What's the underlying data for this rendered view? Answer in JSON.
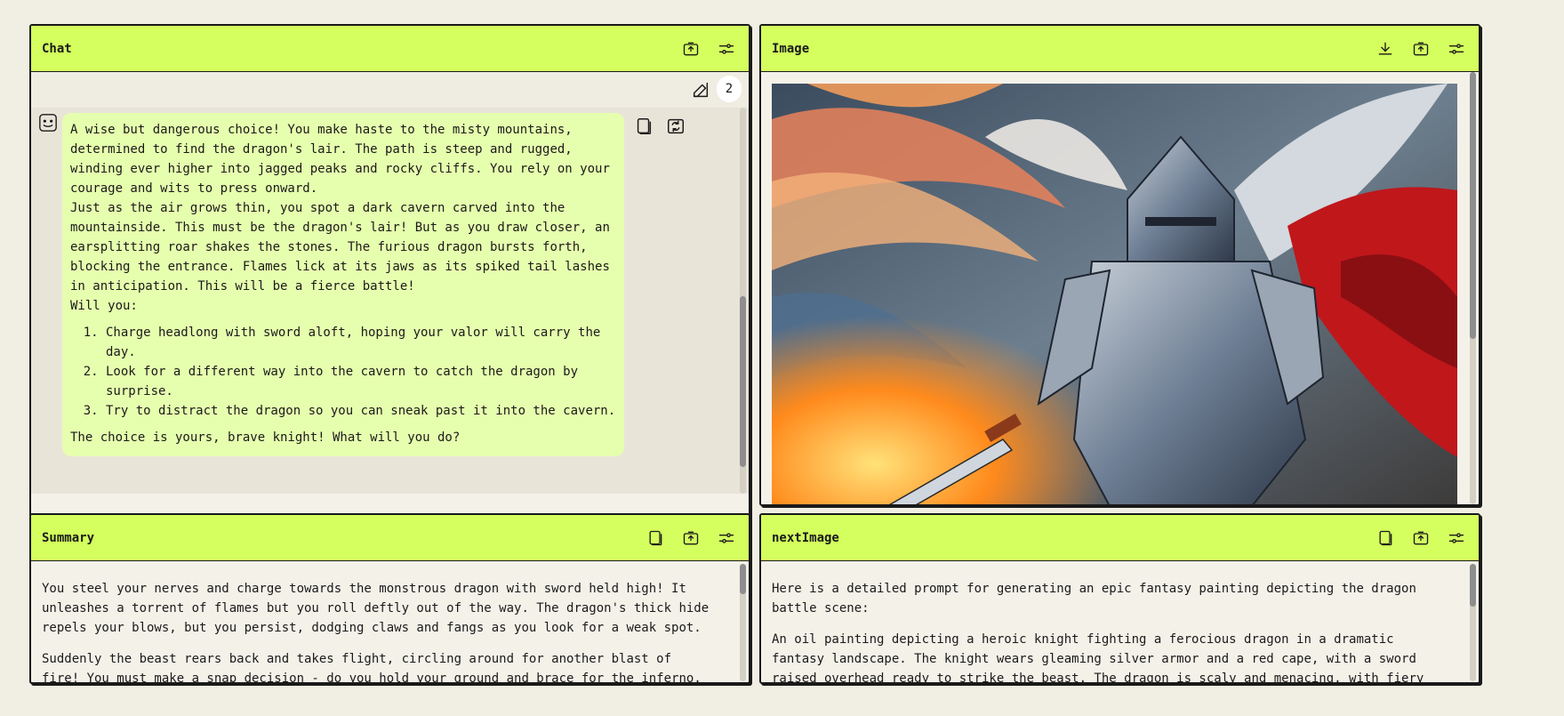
{
  "chat": {
    "title": "Chat",
    "count": "2",
    "message": {
      "intro": "A wise but dangerous choice! You make haste to the misty mountains, determined to find the dragon's lair. The path is steep and rugged, winding ever higher into jagged peaks and rocky cliffs. You rely on your courage and wits to press onward.",
      "para2": "Just as the air grows thin, you spot a dark cavern carved into the mountainside. This must be the dragon's lair! But as you draw closer, an earsplitting roar shakes the stones. The furious dragon bursts forth, blocking the entrance. Flames lick at its jaws as its spiked tail lashes in anticipation. This will be a fierce battle!",
      "prompt": "Will you:",
      "options": [
        "Charge headlong with sword aloft, hoping your valor will carry the day.",
        "Look for a different way into the cavern to catch the dragon by surprise.",
        "Try to distract the dragon so you can sneak past it into the cavern."
      ],
      "closing": "The choice is yours, brave knight! What will you do?"
    },
    "input_placeholder": ""
  },
  "image": {
    "title": "Image"
  },
  "summary": {
    "title": "Summary",
    "paragraphs": [
      "You steel your nerves and charge towards the monstrous dragon with sword held high! It unleashes a torrent of flames but you roll deftly out of the way. The dragon's thick hide repels your blows, but you persist, dodging claws and fangs as you look for a weak spot.",
      "Suddenly the beast rears back and takes flight, circling around for another blast of fire! You must make a snap decision - do you hold your ground and brace for the inferno, or dive for cover behind the rocks?"
    ]
  },
  "nextimage": {
    "title": "nextImage",
    "paragraphs": [
      "Here is a detailed prompt for generating an epic fantasy painting depicting the dragon battle scene:",
      "An oil painting depicting a heroic knight fighting a ferocious dragon in a dramatic fantasy landscape. The knight wears gleaming silver armor and a red cape, with a sword raised overhead ready to strike the beast. The dragon is scaly and menacing, with fiery breath lighting up the scene."
    ]
  },
  "colors": {
    "header": "#d4ff5e",
    "bubble": "#e6ffae",
    "background": "#f1eee3"
  }
}
